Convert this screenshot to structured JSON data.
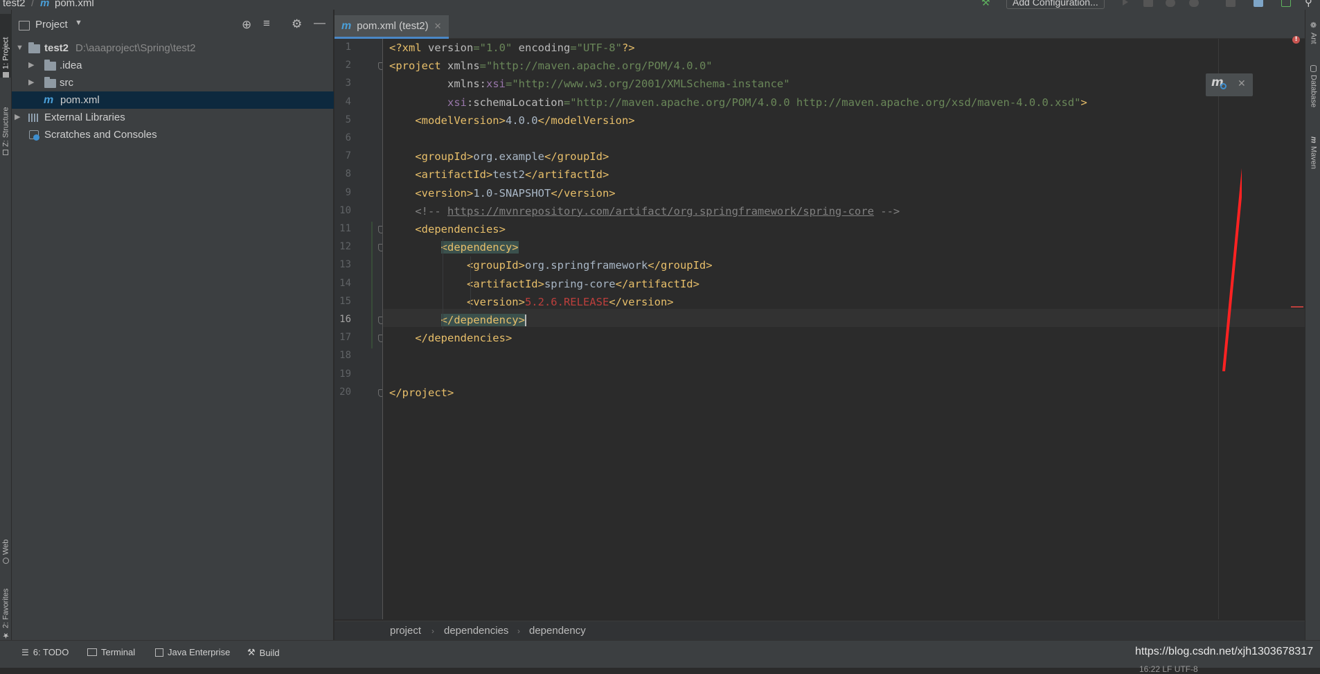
{
  "breadcrumb_top": {
    "project": "test2",
    "file": "pom.xml"
  },
  "toolbar": {
    "add_configuration": "Add Configuration..."
  },
  "left_tabs": {
    "project": "1: Project",
    "structure": "Z: Structure",
    "web": "Web",
    "favorites": "2: Favorites"
  },
  "right_tabs": {
    "ant": "Ant",
    "database": "Database",
    "maven": "Maven"
  },
  "project_panel": {
    "title": "Project",
    "tree": [
      {
        "label": "test2",
        "path": "D:\\aaaproject\\Spring\\test2"
      },
      {
        "label": ".idea"
      },
      {
        "label": "src"
      },
      {
        "label": "pom.xml"
      },
      {
        "label": "External Libraries"
      },
      {
        "label": "Scratches and Consoles"
      }
    ]
  },
  "editor_tab": {
    "label": "pom.xml (test2)"
  },
  "code": {
    "line_numbers": [
      "1",
      "2",
      "3",
      "4",
      "5",
      "6",
      "7",
      "8",
      "9",
      "10",
      "11",
      "12",
      "13",
      "14",
      "15",
      "16",
      "17",
      "18",
      "19",
      "20"
    ],
    "current_line": 16,
    "lines": [
      {
        "n": 1,
        "parts": [
          [
            "t",
            "<?xml "
          ],
          [
            "a",
            "version"
          ],
          [
            "v",
            "=\"1.0\" "
          ],
          [
            "a",
            "encoding"
          ],
          [
            "v",
            "=\"UTF-8\""
          ],
          [
            "t",
            "?>"
          ]
        ]
      },
      {
        "n": 2,
        "parts": [
          [
            "t",
            "<project "
          ],
          [
            "a",
            "xmlns"
          ],
          [
            "v",
            "=\"http://maven.apache.org/POM/4.0.0\""
          ]
        ]
      },
      {
        "n": 3,
        "parts": [
          [
            "a",
            "         xmlns:"
          ],
          [
            "ns",
            "xsi"
          ],
          [
            "v",
            "=\"http://www.w3.org/2001/XMLSchema-instance\""
          ]
        ]
      },
      {
        "n": 4,
        "parts": [
          [
            "ns",
            "         xsi"
          ],
          [
            "a",
            ":schemaLocation"
          ],
          [
            "v",
            "=\"http://maven.apache.org/POM/4.0.0 http://maven.apache.org/xsd/maven-4.0.0.xsd\""
          ],
          [
            "t",
            ">"
          ]
        ]
      },
      {
        "n": 5,
        "parts": [
          [
            "t",
            "    <modelVersion>"
          ],
          [
            "tx",
            "4.0.0"
          ],
          [
            "t",
            "</modelVersion>"
          ]
        ]
      },
      {
        "n": 6,
        "parts": []
      },
      {
        "n": 7,
        "parts": [
          [
            "t",
            "    <groupId>"
          ],
          [
            "tx",
            "org.example"
          ],
          [
            "t",
            "</groupId>"
          ]
        ]
      },
      {
        "n": 8,
        "parts": [
          [
            "t",
            "    <artifactId>"
          ],
          [
            "tx",
            "test2"
          ],
          [
            "t",
            "</artifactId>"
          ]
        ]
      },
      {
        "n": 9,
        "parts": [
          [
            "t",
            "    <version>"
          ],
          [
            "tx",
            "1.0-SNAPSHOT"
          ],
          [
            "t",
            "</version>"
          ]
        ]
      },
      {
        "n": 10,
        "parts": [
          [
            "cm",
            "    <!-- "
          ],
          [
            "cmu",
            "https://mvnrepository.com/artifact/org.springframework/spring-core"
          ],
          [
            "cm",
            " -->"
          ]
        ]
      },
      {
        "n": 11,
        "parts": [
          [
            "t",
            "    <dependencies>"
          ]
        ]
      },
      {
        "n": 12,
        "parts": [
          [
            "a",
            "        "
          ],
          [
            "thl",
            "<dependency>"
          ]
        ]
      },
      {
        "n": 13,
        "parts": [
          [
            "t",
            "            <groupId>"
          ],
          [
            "tx",
            "org.springframework"
          ],
          [
            "t",
            "</groupId>"
          ]
        ]
      },
      {
        "n": 14,
        "parts": [
          [
            "t",
            "            <artifactId>"
          ],
          [
            "tx",
            "spring-core"
          ],
          [
            "t",
            "</artifactId>"
          ]
        ]
      },
      {
        "n": 15,
        "parts": [
          [
            "t",
            "            <version>"
          ],
          [
            "er",
            "5.2.6.RELEASE"
          ],
          [
            "t",
            "</version>"
          ]
        ]
      },
      {
        "n": 16,
        "parts": [
          [
            "a",
            "        "
          ],
          [
            "thl",
            "</dependency>"
          ]
        ]
      },
      {
        "n": 17,
        "parts": [
          [
            "t",
            "    </dependencies>"
          ]
        ]
      },
      {
        "n": 18,
        "parts": []
      },
      {
        "n": 19,
        "parts": []
      },
      {
        "n": 20,
        "parts": [
          [
            "t",
            "</project>"
          ]
        ]
      }
    ]
  },
  "editor_breadcrumbs": [
    "project",
    "dependencies",
    "dependency"
  ],
  "bottom_tools": {
    "todo": "6: TODO",
    "terminal": "Terminal",
    "java_enterprise": "Java Enterprise",
    "build": "Build"
  },
  "watermark": "https://blog.csdn.net/xjh1303678317",
  "status": "16:22   LF   UTF-8",
  "colors": {
    "accent": "#4a88c7",
    "annotation_arrow": "#ff2222",
    "maven_icon": "#4a9fd8"
  }
}
